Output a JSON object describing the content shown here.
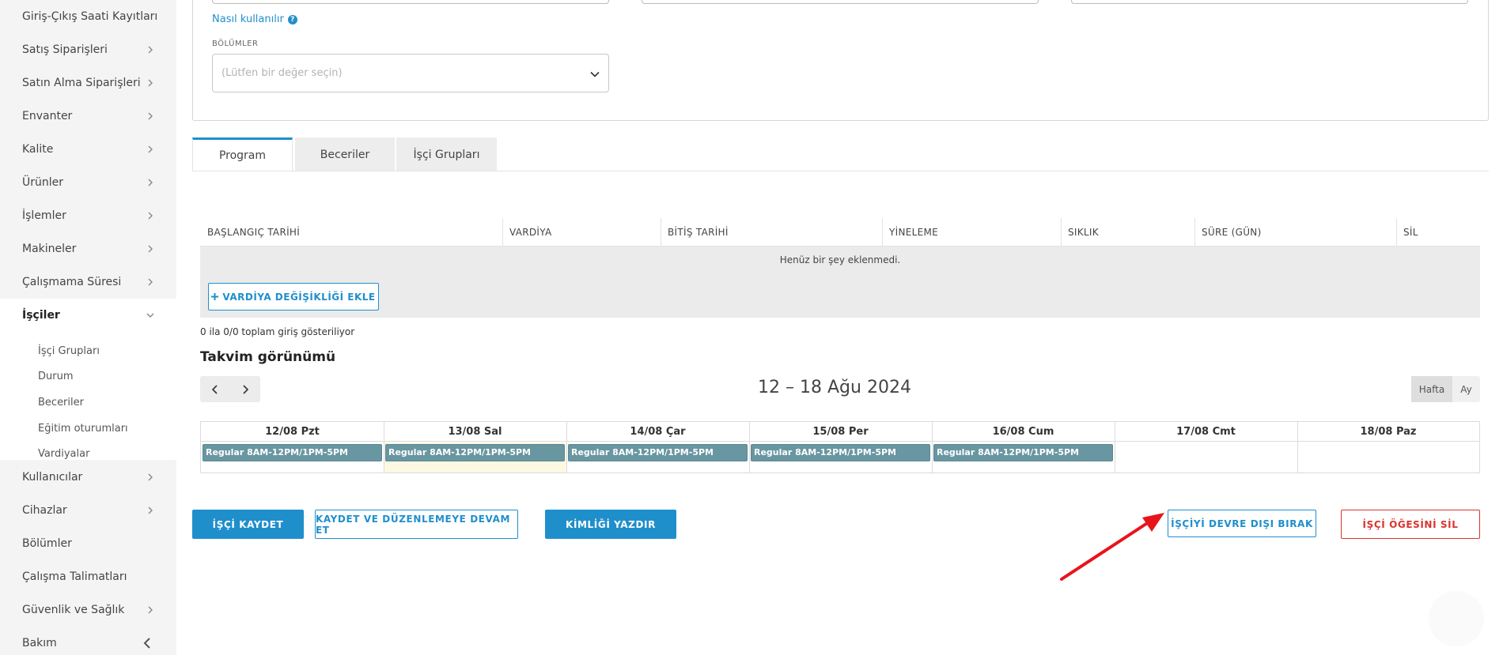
{
  "sidebar": {
    "items": [
      {
        "label": "Giriş-Çıkış Saati Kayıtları",
        "has_chevron": false
      },
      {
        "label": "Satış Siparişleri",
        "has_chevron": true
      },
      {
        "label": "Satın Alma Siparişleri",
        "has_chevron": true
      },
      {
        "label": "Envanter",
        "has_chevron": true
      },
      {
        "label": "Kalite",
        "has_chevron": true
      },
      {
        "label": "Ürünler",
        "has_chevron": true
      },
      {
        "label": "İşlemler",
        "has_chevron": true
      },
      {
        "label": "Makineler",
        "has_chevron": true
      },
      {
        "label": "Çalışmama Süresi",
        "has_chevron": true
      },
      {
        "label": "İşçiler",
        "has_chevron": true,
        "expanded": true
      },
      {
        "label": "Kullanıcılar",
        "has_chevron": true
      },
      {
        "label": "Cihazlar",
        "has_chevron": true
      },
      {
        "label": "Bölümler",
        "has_chevron": false
      },
      {
        "label": "Çalışma Talimatları",
        "has_chevron": false
      },
      {
        "label": "Güvenlik ve Sağlık",
        "has_chevron": true
      },
      {
        "label": "Bakım",
        "has_chevron": false
      }
    ],
    "subitems": [
      "İşçi Grupları",
      "Durum",
      "Beceriler",
      "Eğitim oturumları",
      "Vardiyalar"
    ]
  },
  "form": {
    "how_to_link": "Nasıl kullanılır",
    "departments_label": "BÖLÜMLER",
    "departments_placeholder": "(Lütfen bir değer seçin)"
  },
  "tabs": [
    "Program",
    "Beceriler",
    "İşçi Grupları"
  ],
  "schedule_table": {
    "columns": [
      "BAŞLANGIÇ TARİHİ",
      "VARDİYA",
      "BİTİŞ TARİHİ",
      "YİNELEME",
      "SIKLIK",
      "SÜRE (GÜN)",
      "SİL"
    ],
    "empty_text": "Henüz bir şey eklenmedi.",
    "add_button": "VARDİYA DEĞİŞİKLİĞİ EKLE",
    "entries_info": "0 ila 0/0 toplam giriş gösteriliyor"
  },
  "calendar": {
    "title": "Takvim görünümü",
    "date_range": "12 – 18 Ağu 2024",
    "view_week": "Hafta",
    "view_month": "Ay",
    "days": [
      "12/08 Pzt",
      "13/08 Sal",
      "14/08 Çar",
      "15/08 Per",
      "16/08 Cum",
      "17/08 Cmt",
      "18/08 Paz"
    ],
    "events": [
      {
        "day": "12/08 Pzt",
        "label": "Regular 8AM-12PM/1PM-5PM"
      },
      {
        "day": "13/08 Sal",
        "label": "Regular 8AM-12PM/1PM-5PM"
      },
      {
        "day": "14/08 Çar",
        "label": "Regular 8AM-12PM/1PM-5PM"
      },
      {
        "day": "15/08 Per",
        "label": "Regular 8AM-12PM/1PM-5PM"
      },
      {
        "day": "16/08 Cum",
        "label": "Regular 8AM-12PM/1PM-5PM"
      }
    ],
    "today": "13/08 Sal"
  },
  "actions": {
    "save": "İŞÇİ KAYDET",
    "save_continue": "KAYDET VE DÜZENLEMEYE DEVAM ET",
    "print_id": "KİMLİĞİ YAZDIR",
    "deactivate": "İŞÇİYİ DEVRE DIŞI BIRAK",
    "delete": "İŞÇİ ÖĞESİNİ SİL"
  },
  "colors": {
    "accent": "#1f8fcc",
    "danger": "#d9342b",
    "event": "#6896a1",
    "today_highlight": "#fcf8e3",
    "annotation_arrow": "#e8141b"
  }
}
